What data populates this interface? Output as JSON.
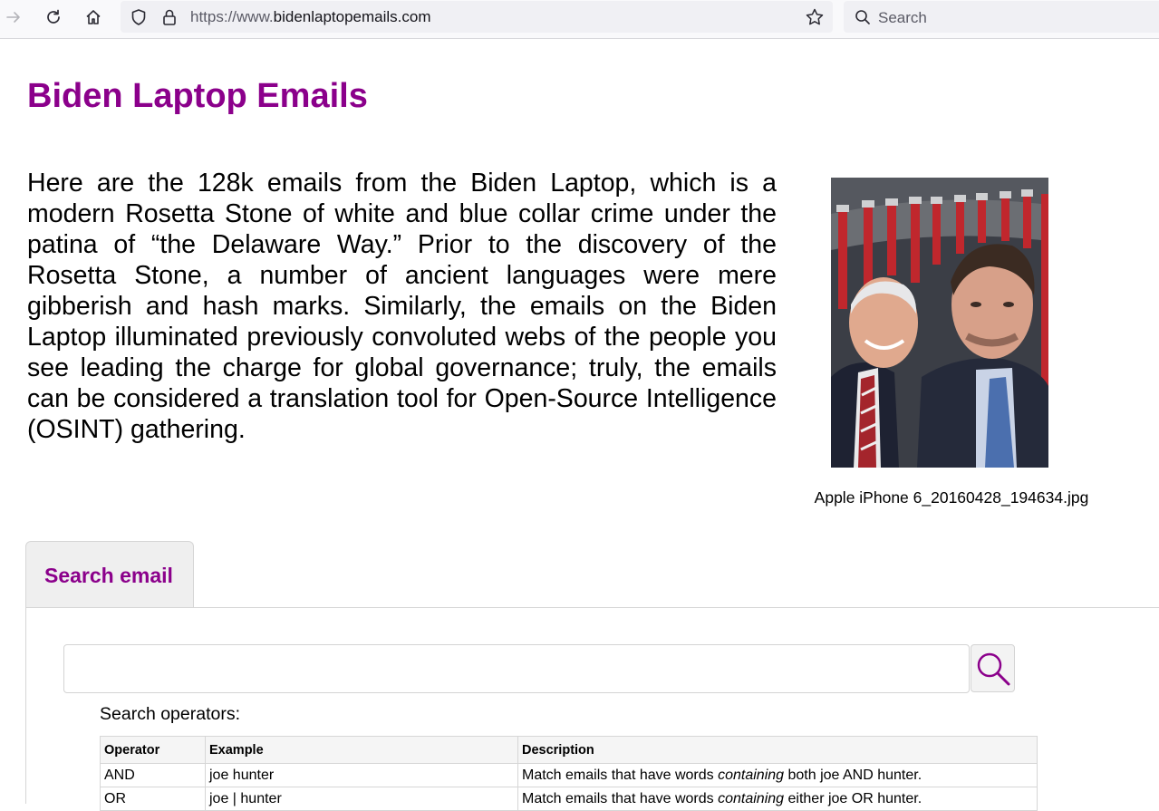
{
  "browser": {
    "url_scheme": "https://www.",
    "url_host": "bidenlaptopemails.com",
    "search_placeholder": "Search",
    "icons": [
      "forward-icon",
      "reload-icon",
      "home-icon",
      "shield-icon",
      "lock-icon",
      "bookmark-star-icon",
      "search-icon"
    ]
  },
  "page": {
    "title": "Biden Laptop Emails",
    "intro": "Here are the 128k emails from the Biden Laptop, which is a modern Rosetta Stone of white and blue collar crime under the patina of “the Delaware Way.” Prior to the discovery of the Rosetta Stone, a number of ancient languages were mere gibberish and hash marks. Similarly, the emails on the Biden Laptop illuminated previously convoluted webs of the people you see leading the charge for global governance; truly, the emails can be considered a translation tool for Open-Source Intelligence (OSINT) gathering.",
    "photo_caption": "Apple iPhone 6_20160428_194634.jpg",
    "accent_color": "#8b008b"
  },
  "search": {
    "tab_label": "Search email",
    "input_value": "",
    "operators_label": "Search operators:",
    "columns": [
      "Operator",
      "Example",
      "Description"
    ],
    "rows": [
      {
        "operator": "AND",
        "example": "joe hunter",
        "desc_pre": "Match emails that have words ",
        "desc_em": "containing",
        "desc_post": " both joe AND hunter."
      },
      {
        "operator": "OR",
        "example": "joe | hunter",
        "desc_pre": "Match emails that have words ",
        "desc_em": "containing",
        "desc_post": " either joe OR hunter."
      }
    ]
  }
}
